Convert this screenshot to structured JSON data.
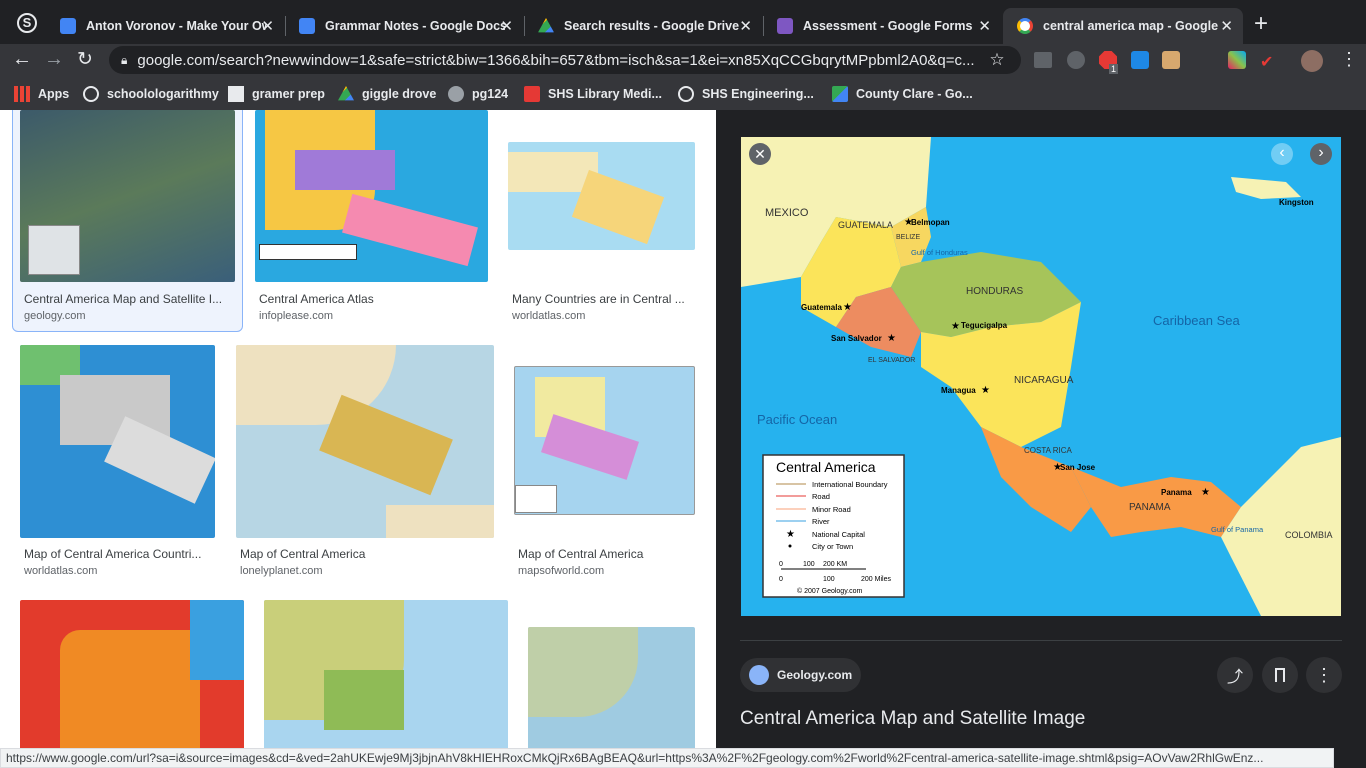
{
  "tabs": [
    {
      "title": "Anton Voronov - Make Your Ow"
    },
    {
      "title": "Grammar Notes - Google Docs"
    },
    {
      "title": "Search results - Google Drive"
    },
    {
      "title": "Assessment - Google Forms"
    },
    {
      "title": "central america map - Google S"
    }
  ],
  "new_tab_symbol": "+",
  "address": {
    "url": "google.com/search?newwindow=1&safe=strict&biw=1366&bih=657&tbm=isch&sa=1&ei=xn85XqCCGbqrytMPpbml2A0&q=c..."
  },
  "bookmarks": [
    "Apps",
    "schoolologarithmy",
    "gramer prep",
    "giggle drove",
    "pg124",
    "SHS Library Medi...",
    "SHS Engineering...",
    "County Clare - Go..."
  ],
  "extension_badge": "1",
  "results": [
    {
      "caption": "Central America Map and Satellite I...",
      "domain": "geology.com"
    },
    {
      "caption": "Central America Atlas",
      "domain": "infoplease.com"
    },
    {
      "caption": "Many Countries are in Central ...",
      "domain": "worldatlas.com"
    },
    {
      "caption": "Map of Central America Countri...",
      "domain": "worldatlas.com"
    },
    {
      "caption": "Map of Central America",
      "domain": "lonelyplanet.com"
    },
    {
      "caption": "Map of Central America",
      "domain": "mapsofworld.com"
    }
  ],
  "panel": {
    "source": "Geology.com",
    "title": "Central America Map and Satellite Image",
    "map": {
      "legend_title": "Central America",
      "legend_items": [
        "International Boundary",
        "Road",
        "Minor Road",
        "River",
        "National Capital",
        "City or Town"
      ],
      "scale_km": [
        "0",
        "100",
        "200 KM"
      ],
      "scale_mi": [
        "0",
        "100",
        "200 Miles"
      ],
      "copyright": "© 2007 Geology.com",
      "countries": [
        "MEXICO",
        "GUATEMALA",
        "BELIZE",
        "HONDURAS",
        "EL SALVADOR",
        "NICARAGUA",
        "COSTA RICA",
        "PANAMA",
        "COLOMBIA"
      ],
      "seas": [
        "Caribbean Sea",
        "Pacific Ocean",
        "Gulf of Honduras",
        "Gulf of Panama"
      ],
      "cities": [
        "Belmopan",
        "Guatemala",
        "San Salvador",
        "Tegucigalpa",
        "Managua",
        "San Jose",
        "Panama",
        "Kingston"
      ]
    }
  },
  "status_url": "https://www.google.com/url?sa=i&source=images&cd=&ved=2ahUKEwje9Mj3jbjnAhV8kHIEHRoxCMkQjRx6BAgBEAQ&url=https%3A%2F%2Fgeology.com%2Fworld%2Fcentral-america-satellite-image.shtml&psig=AOvVaw2RhlGwEnz..."
}
